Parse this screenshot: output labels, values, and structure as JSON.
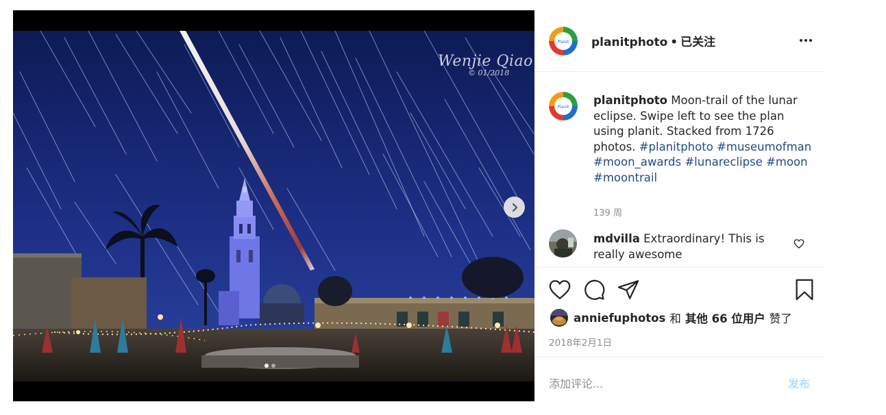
{
  "post": {
    "watermark_name": "Wenjie Qiao",
    "watermark_date": "01/2018",
    "carousel": {
      "total": 2,
      "current": 1
    }
  },
  "header": {
    "username": "planitphoto",
    "separator": "•",
    "follow_status": "已关注",
    "avatar_text": "PlanIt"
  },
  "caption": {
    "username": "planitphoto",
    "text": "Moon-trail of the lunar eclipse. Swipe left to see the plan using planit. Stacked from 1726 photos.",
    "hashtags": [
      "#planitphoto",
      "#museumofman",
      "#moon_awards",
      "#lunareclipse",
      "#moon",
      "#moontrail"
    ],
    "time": "139 周"
  },
  "comment": {
    "username": "mdvilla",
    "text": "Extraordinary! This is really awesome"
  },
  "likes": {
    "username": "anniefuphotos",
    "connector": "和",
    "others": "其他 66 位用户",
    "suffix": "赞了"
  },
  "date": "2018年2月1日",
  "add_comment": {
    "placeholder": "添加评论...",
    "post_label": "发布"
  },
  "colors": {
    "hashtag": "#1e4b86",
    "post_button": "#b2dffc",
    "sky_top": "#0f1f5e",
    "sky_bottom": "#2a3f9a",
    "tower": "#7f86ef"
  },
  "icons": [
    "chevron-right-icon",
    "more-icon",
    "heart-icon",
    "comment-icon",
    "share-icon",
    "bookmark-icon"
  ]
}
